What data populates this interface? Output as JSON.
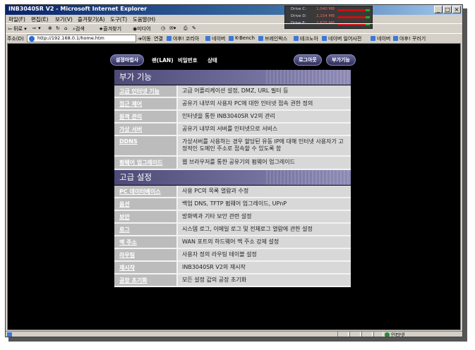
{
  "window": {
    "title": "INB3040SR V2 - Microsoft Internet Explorer",
    "min_glyph": "_",
    "max_glyph": "□",
    "close_glyph": "×"
  },
  "drives": [
    {
      "label": "Drive C:",
      "value": "1,040 MB"
    },
    {
      "label": "Drive D:",
      "value": "2,154 MB"
    },
    {
      "label": "Drive E:",
      "value": "2,675 MB"
    }
  ],
  "menu": [
    "파일(F)",
    "편집(E)",
    "보기(V)",
    "즐겨찾기(A)",
    "도구(T)",
    "도움말(H)"
  ],
  "toolbar": {
    "back": "뒤로",
    "search": "검색",
    "favorites": "즐겨찾기",
    "media": "미디어"
  },
  "address": {
    "label": "주소(D)",
    "url": "http://192.168.0.1/home.htm",
    "go": "이동",
    "links_label": "연결",
    "links": [
      "야후! 코리아",
      "네이버",
      "K-Bench",
      "브레인박스",
      "테크노아",
      "네이버 일어사전",
      "네이버",
      "야후! 꾸러기"
    ]
  },
  "nav": {
    "setup_wizard": "설정마법사",
    "lan": "랜(LAN)",
    "password": "비밀번호",
    "status": "상태",
    "logout": "로그아웃",
    "extra": "부가기능"
  },
  "sections": [
    {
      "title": "부가 기능",
      "rows": [
        {
          "name": "고급 인터넷 기능",
          "desc": "고급 어플리케이션 설정, DMZ, URL 필터 등"
        },
        {
          "name": "접근 제어",
          "desc": "공유기 내부의 사용자 PC에 대한 인터넷 접속 권한 정의"
        },
        {
          "name": "원격 관리",
          "desc": "인터넷을 통한 INB3040SR V2의 관리"
        },
        {
          "name": "가상 서버",
          "desc": "공유기 내부의 서버를 인터넷으로 서비스"
        },
        {
          "name": "DDNS",
          "desc": "가상서버를 사용하는 경우 할당된 유동 IP에 대해 인터넷 사용자가 고정적인 도메인 주소로 접속할 수 있도록 함"
        },
        {
          "name": "펌웨어 업그레이드",
          "desc": "웹 브라우저를 통한 공유기의 펌웨어 업그레이드"
        }
      ]
    },
    {
      "title": "고급 설정",
      "rows": [
        {
          "name": "PC 데이터베이스",
          "desc": "사용 PC의 목록 열람과 수정"
        },
        {
          "name": "옵션",
          "desc": "백업 DNS, TFTP 펌웨어 업그레이드, UPnP"
        },
        {
          "name": "보안",
          "desc": "방화벽과 기타 보안 관련 설정"
        },
        {
          "name": "로그",
          "desc": "시스템 로그, 이메일 로그 및 전체로그 열람에 관한 설정"
        },
        {
          "name": "맥 주소",
          "desc": "WAN 포트의 하드웨어 맥 주소 강제 설정"
        },
        {
          "name": "라우팅",
          "desc": "사용자 정의 라우팅 테이블 설정"
        },
        {
          "name": "재시작",
          "desc": "INB3040SR V2의 재시작"
        },
        {
          "name": "공장 초기화",
          "desc": "모든 설정 값의 공장 초기화"
        }
      ]
    }
  ],
  "statusbar": {
    "zone": "인터넷"
  }
}
